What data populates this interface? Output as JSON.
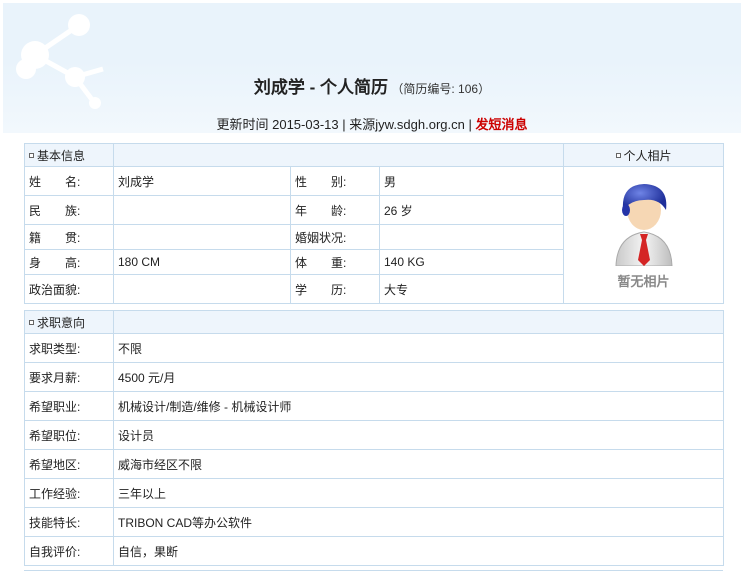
{
  "header": {
    "title": "刘成学 - 个人简历",
    "subtitle": "（简历编号: 106）",
    "updated_prefix": "更新时间",
    "updated": "2015-03-13",
    "sep1": "|",
    "source_prefix": "来源",
    "source": "jyw.sdgh.org.cn",
    "sep2": "|",
    "sms_link": "发短消息"
  },
  "basic": {
    "section_title": "基本信息",
    "photo_title": "个人相片",
    "photo_caption": "暂无相片",
    "rows": [
      {
        "l1": "姓　　名:",
        "v1": "刘成学",
        "l2": "性　　别:",
        "v2": "男"
      },
      {
        "l1": "民　　族:",
        "v1": "",
        "l2": "年　　龄:",
        "v2": "26 岁"
      },
      {
        "l1": "籍　　贯:",
        "v1": "",
        "l2": "婚姻状况:",
        "v2": ""
      },
      {
        "l1": "身　　高:",
        "v1": "180 CM",
        "l2": "体　　重:",
        "v2": "140 KG"
      },
      {
        "l1": "政治面貌:",
        "v1": "",
        "l2": "学　　历:",
        "v2": "大专"
      }
    ]
  },
  "intent": {
    "section_title": "求职意向",
    "rows": [
      {
        "label": "求职类型:",
        "value": "不限"
      },
      {
        "label": "要求月薪:",
        "value": "4500 元/月"
      },
      {
        "label": "希望职业:",
        "value": "机械设计/制造/维修 - 机械设计师"
      },
      {
        "label": "希望职位:",
        "value": "设计员"
      },
      {
        "label": "希望地区:",
        "value": "威海市经区不限"
      },
      {
        "label": "工作经验:",
        "value": "三年以上"
      },
      {
        "label": "技能特长:",
        "value": "TRIBON CAD等办公软件"
      },
      {
        "label": "自我评价:",
        "value": "自信，果断"
      }
    ]
  },
  "colors": {
    "border": "#c6dbec",
    "header_bg": "#e9f3fb",
    "sms": "#cc0000"
  }
}
